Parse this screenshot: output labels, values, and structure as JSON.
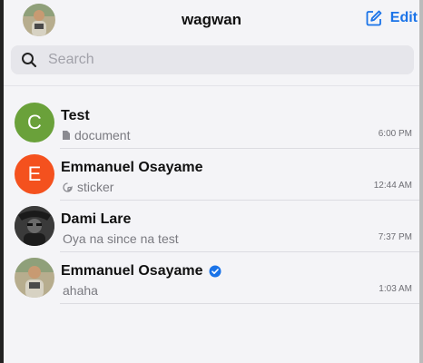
{
  "header": {
    "title": "wagwan",
    "edit_label": "Edit"
  },
  "search": {
    "placeholder": "Search",
    "value": ""
  },
  "colors": {
    "accent": "#1a73e8",
    "avatar_green": "#6aa13a",
    "avatar_orange": "#f4511e"
  },
  "chats": [
    {
      "name": "Test",
      "avatar_letter": "C",
      "preview": "document",
      "preview_icon": "document-icon",
      "time": "6:00 PM",
      "verified": false
    },
    {
      "name": "Emmanuel Osayame",
      "avatar_letter": "E",
      "preview": "sticker",
      "preview_icon": "sticker-icon",
      "time": "12:44 AM",
      "verified": false
    },
    {
      "name": "Dami Lare",
      "avatar_letter": "",
      "preview": "Oya na since na test",
      "preview_icon": "",
      "time": "7:37 PM",
      "verified": false
    },
    {
      "name": "Emmanuel Osayame",
      "avatar_letter": "",
      "preview": "ahaha",
      "preview_icon": "",
      "time": "1:03 AM",
      "verified": true
    }
  ]
}
